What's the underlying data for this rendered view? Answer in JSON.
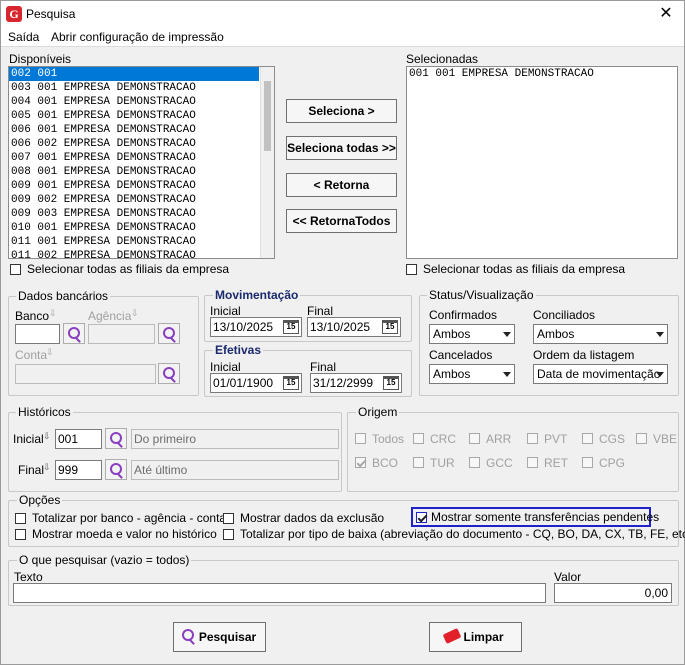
{
  "window": {
    "title": "Pesquisa",
    "close_glyph": "✕",
    "logo_letter": "G"
  },
  "menu": {
    "items": [
      "Saída",
      "Abrir configuração de impressão"
    ]
  },
  "disponiveis": {
    "label": "Disponíveis",
    "rows": [
      "002 001",
      "003 001 EMPRESA DEMONSTRACAO",
      "004 001 EMPRESA DEMONSTRACAO",
      "005 001 EMPRESA DEMONSTRACAO",
      "006 001 EMPRESA DEMONSTRACAO",
      "006 002 EMPRESA DEMONSTRACAO",
      "007 001 EMPRESA DEMONSTRACAO",
      "008 001 EMPRESA DEMONSTRACAO",
      "009 001 EMPRESA DEMONSTRACAO",
      "009 002 EMPRESA DEMONSTRACAO",
      "009 003 EMPRESA DEMONSTRACAO",
      "010 001 EMPRESA DEMONSTRACAO",
      "011 001 EMPRESA DEMONSTRACAO",
      "011 002 EMPRESA DEMONSTRACAO"
    ],
    "select_all": "Selecionar todas as filiais da empresa"
  },
  "selecionadas": {
    "label": "Selecionadas",
    "rows": [
      "001 001 EMPRESA DEMONSTRACAO"
    ],
    "select_all": "Selecionar todas as filiais da empresa"
  },
  "transfer": {
    "seleciona": "Seleciona >",
    "seleciona_todas": "Seleciona todas >>",
    "retorna": "< Retorna",
    "retorna_todos": "<< RetornaTodos"
  },
  "dados_bancarios": {
    "title": "Dados bancários",
    "banco": "Banco",
    "agencia": "Agência",
    "conta": "Conta"
  },
  "movimentacao": {
    "title": "Movimentação",
    "inicial_label": "Inicial",
    "inicial": "13/10/2025",
    "final_label": "Final",
    "final": "13/10/2025",
    "cal_label": "15"
  },
  "efetivas": {
    "title": "Efetivas",
    "inicial_label": "Inicial",
    "inicial": "01/01/1900",
    "final_label": "Final",
    "final": "31/12/2999",
    "cal_label": "15"
  },
  "status": {
    "title": "Status/Visualização",
    "confirmados_label": "Confirmados",
    "confirmados": "Ambos",
    "conciliados_label": "Conciliados",
    "conciliados": "Ambos",
    "cancelados_label": "Cancelados",
    "cancelados": "Ambos",
    "ordem_label": "Ordem da listagem",
    "ordem": "Data de movimentação"
  },
  "historicos": {
    "title": "Históricos",
    "inicial_label": "Inicial",
    "inicial_code": "001",
    "inicial_desc": "Do primeiro",
    "final_label": "Final",
    "final_code": "999",
    "final_desc": "Até último"
  },
  "origem": {
    "title": "Origem",
    "row1": [
      "Todos",
      "CRC",
      "ARR",
      "PVT",
      "CGS",
      "VBE"
    ],
    "row2": [
      "BCO",
      "TUR",
      "GCC",
      "RET",
      "CPG"
    ]
  },
  "opcoes": {
    "title": "Opções",
    "totalizar_banco": "Totalizar por banco - agência - conta",
    "mostrar_moeda": "Mostrar moeda e valor no histórico",
    "mostrar_exclusao": "Mostrar dados da exclusão",
    "totalizar_baixa": "Totalizar por tipo de baixa (abreviação do documento - CQ, BO, DA, CX, TB, FE, etc.)",
    "mostrar_pendentes": "Mostrar somente transferências pendentes"
  },
  "oque": {
    "title": "O que pesquisar (vazio = todos)",
    "texto_label": "Texto",
    "texto": "",
    "valor_label": "Valor",
    "valor": "0,00"
  },
  "actions": {
    "pesquisar": "Pesquisar",
    "limpar": "Limpar"
  },
  "colors": {
    "accent": "#0078d7",
    "focus_border": "#1e22c8",
    "section_title": "#1a2a6c"
  }
}
